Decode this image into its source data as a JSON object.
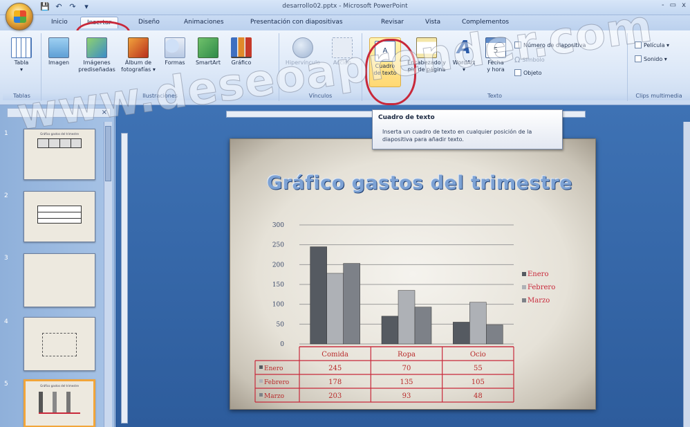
{
  "window": {
    "title": "desarrollo02.pptx - Microsoft PowerPoint",
    "controls": [
      "-",
      "▭",
      "x"
    ]
  },
  "qat": [
    "💾",
    "↶",
    "↷",
    "▾"
  ],
  "tabs": [
    {
      "label": "Inicio",
      "active": false
    },
    {
      "label": "Insertar",
      "active": true
    },
    {
      "label": "Diseño",
      "active": false
    },
    {
      "label": "Animaciones",
      "active": false
    },
    {
      "label": "Presentación con diapositivas",
      "active": false
    },
    {
      "label": "Revisar",
      "active": false
    },
    {
      "label": "Vista",
      "active": false
    },
    {
      "label": "Complementos",
      "active": false
    }
  ],
  "ribbon": {
    "tablas": {
      "label": "Tablas",
      "buttons": [
        {
          "l1": "Tabla",
          "l2": "▾"
        }
      ]
    },
    "ilustraciones": {
      "label": "Ilustraciones",
      "buttons": [
        {
          "l1": "Imagen",
          "l2": ""
        },
        {
          "l1": "Imágenes",
          "l2": "prediseñadas"
        },
        {
          "l1": "Álbum de",
          "l2": "fotografías ▾"
        },
        {
          "l1": "Formas",
          "l2": ""
        },
        {
          "l1": "SmartArt",
          "l2": ""
        },
        {
          "l1": "Gráfico",
          "l2": ""
        }
      ]
    },
    "vinculos": {
      "label": "Vínculos",
      "buttons": [
        {
          "l1": "Hipervínculo",
          "l2": ""
        },
        {
          "l1": "Acción",
          "l2": ""
        }
      ]
    },
    "texto": {
      "label": "Texto",
      "buttons": [
        {
          "l1": "Cuadro",
          "l2": "de texto"
        },
        {
          "l1": "Encabezado y",
          "l2": "pie de página"
        },
        {
          "l1": "WordArt",
          "l2": "▾"
        },
        {
          "l1": "Fecha",
          "l2": "y hora"
        }
      ],
      "small": [
        "Número de diapositiva",
        "Símbolo",
        "Objeto"
      ]
    },
    "clips": {
      "label": "Clips multimedia",
      "small": [
        "Película ▾",
        "Sonido ▾"
      ]
    }
  },
  "tooltip": {
    "title": "Cuadro de texto",
    "body": "Inserta un cuadro de texto en cualquier posición de la diapositiva para añadir texto."
  },
  "slide_panel": {
    "numbers": [
      "1",
      "2",
      "3",
      "4",
      "5"
    ],
    "thumb_titles": [
      "Gráfico gastos del trimestre"
    ]
  },
  "slide": {
    "title": "Gráfico gastos del trimestre"
  },
  "chart_data": {
    "type": "bar",
    "title": "Gráfico gastos del trimestre",
    "categories": [
      "Comida",
      "Ropa",
      "Ocio"
    ],
    "series": [
      {
        "name": "Enero",
        "values": [
          245,
          70,
          55
        ],
        "color": "#555a61"
      },
      {
        "name": "Febrero",
        "values": [
          178,
          135,
          105
        ],
        "color": "#aeb1b6"
      },
      {
        "name": "Marzo",
        "values": [
          203,
          93,
          48
        ],
        "color": "#7d8188"
      }
    ],
    "ylim": [
      0,
      300
    ],
    "yticks": [
      0,
      50,
      100,
      150,
      200,
      250,
      300
    ],
    "legend": "right",
    "grid": true,
    "data_table": true
  },
  "watermark": "www.deseoaprender.com",
  "colors": {
    "annotation": "#c8283a",
    "legend_text": "#c8283a",
    "table_text": "#b82a2a"
  }
}
